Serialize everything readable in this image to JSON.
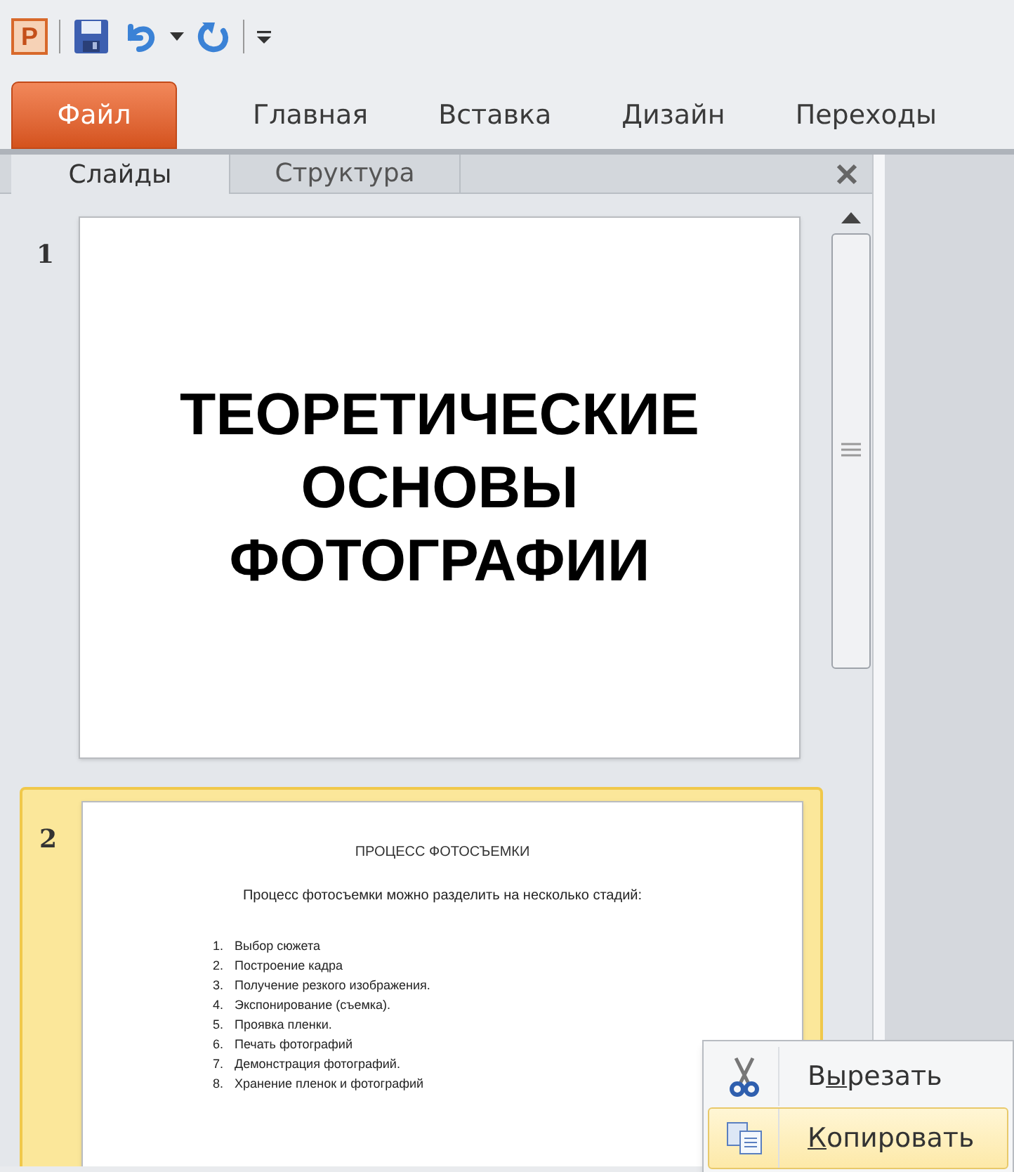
{
  "quick_access_toolbar": {
    "app_icon": "P",
    "items": [
      {
        "kind": "save"
      },
      {
        "kind": "undo"
      },
      {
        "kind": "dropdown"
      },
      {
        "kind": "redo"
      },
      {
        "kind": "customize"
      }
    ]
  },
  "ribbon_tabs": [
    {
      "label": "Файл",
      "selected": true
    },
    {
      "label": "Главная",
      "selected": false
    },
    {
      "label": "Вставка",
      "selected": false
    },
    {
      "label": "Дизайн",
      "selected": false
    },
    {
      "label": "Переходы",
      "selected": false
    }
  ],
  "pane_tabs": [
    {
      "label": "Слайды",
      "selected": true
    },
    {
      "label": "Структура",
      "selected": false
    }
  ],
  "slides": [
    {
      "number": "1",
      "selected": false,
      "kind": "title",
      "title": [
        "ТЕОРЕТИЧЕСКИЕ",
        "ОСНОВЫ",
        "ФОТОГРАФИИ"
      ]
    },
    {
      "number": "2",
      "selected": true,
      "kind": "list",
      "title": [
        "ПРОЦЕСС ФОТОСЪЕМКИ"
      ],
      "intro": "Процесс фотосъемки можно разделить на несколько стадий:",
      "items": [
        {
          "n": "1.",
          "text": "Выбор сюжета"
        },
        {
          "n": "2.",
          "text": "Построение кадра"
        },
        {
          "n": "3.",
          "text": "Получение резкого изображения."
        },
        {
          "n": "4.",
          "text": "Экспонирование (съемка)."
        },
        {
          "n": "5.",
          "text": "Проявка пленки."
        },
        {
          "n": "6.",
          "text": "Печать фотографий"
        },
        {
          "n": "7.",
          "text": "Демонстрация фотографий."
        },
        {
          "n": "8.",
          "text": "Хранение пленок и фотографий"
        }
      ]
    }
  ],
  "context_menu": [
    {
      "kind": "cut",
      "before": "В",
      "key": "ы",
      "after": "резать",
      "selected": false
    },
    {
      "kind": "copy",
      "key": "К",
      "after": "опировать",
      "selected": true
    }
  ]
}
